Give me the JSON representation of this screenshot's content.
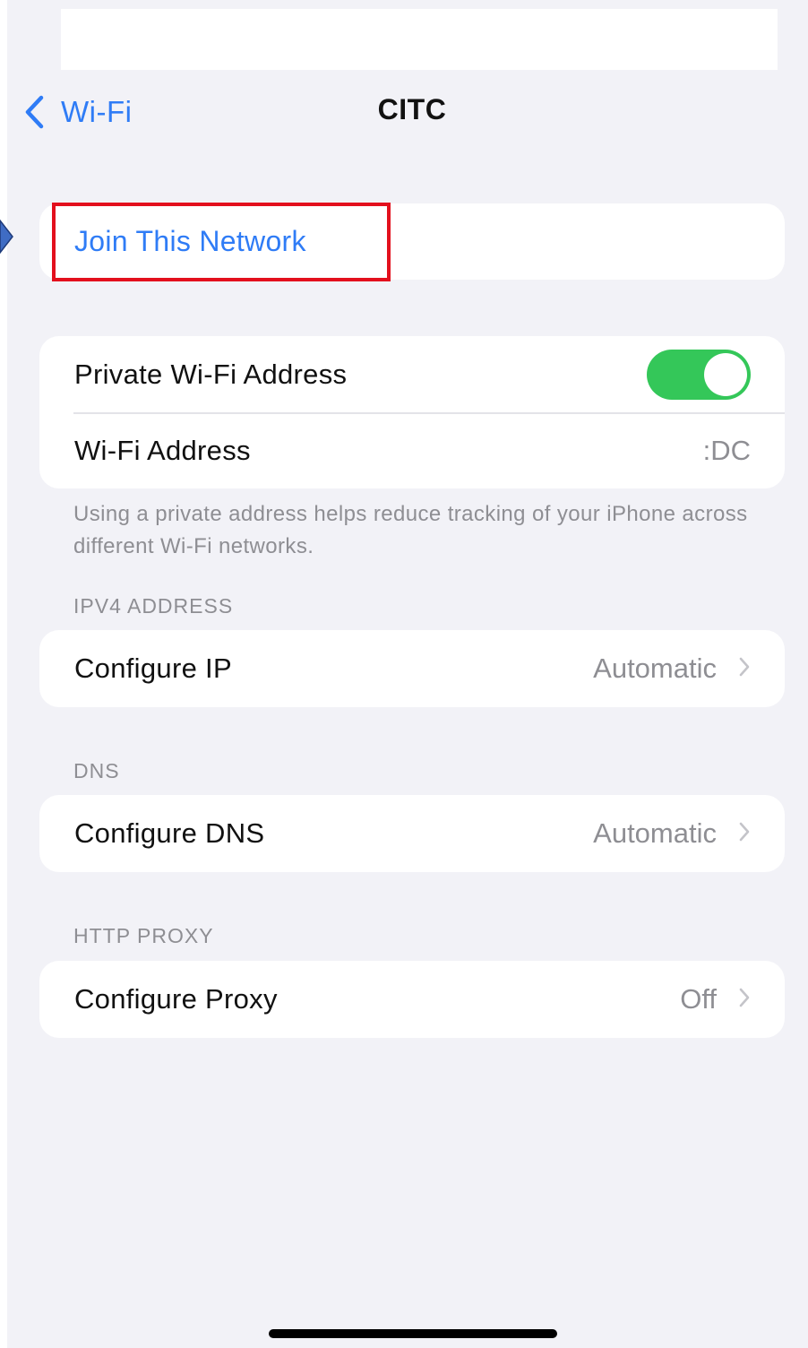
{
  "nav": {
    "back_label": "Wi-Fi",
    "title": "CITC"
  },
  "join": {
    "label": "Join This Network"
  },
  "privacy": {
    "private_address_label": "Private Wi-Fi Address",
    "private_address_enabled": true,
    "wifi_address_label": "Wi-Fi Address",
    "wifi_address_value": ":DC",
    "note": "Using a private address helps reduce tracking of your iPhone across different Wi-Fi networks."
  },
  "ipv4": {
    "header": "IPV4 ADDRESS",
    "configure_label": "Configure IP",
    "configure_value": "Automatic"
  },
  "dns": {
    "header": "DNS",
    "configure_label": "Configure DNS",
    "configure_value": "Automatic"
  },
  "proxy": {
    "header": "HTTP PROXY",
    "configure_label": "Configure Proxy",
    "configure_value": "Off"
  },
  "colors": {
    "accent": "#2f7cf6",
    "toggle_on": "#34c759",
    "highlight": "#e3101d",
    "background": "#f2f2f7"
  },
  "icons": {
    "back": "chevron-left-icon",
    "disclosure": "chevron-right-icon",
    "pointer": "arrow-right-icon"
  }
}
